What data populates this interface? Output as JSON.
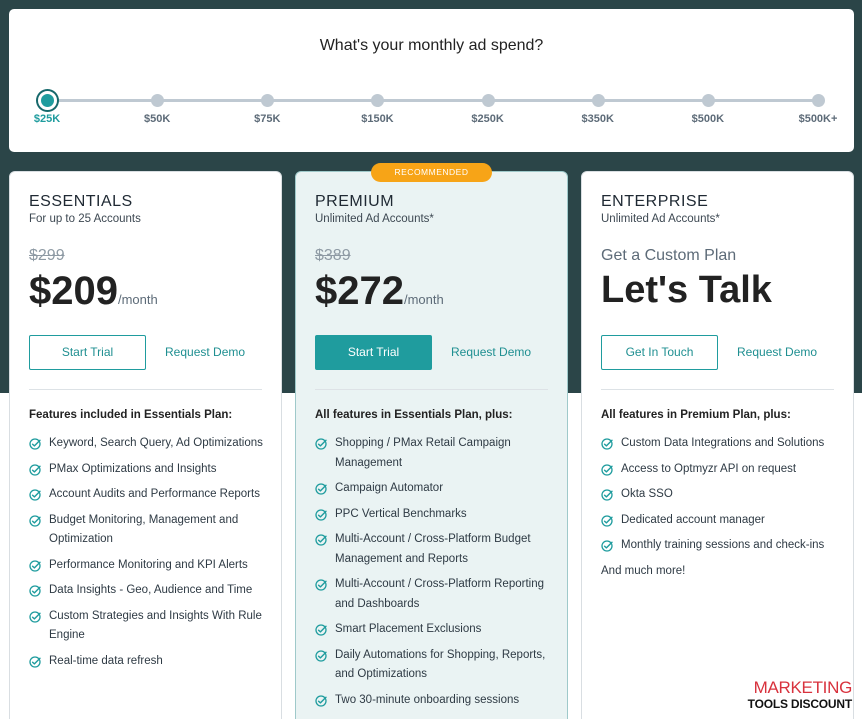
{
  "spend": {
    "title": "What's your monthly ad spend?",
    "stops": [
      "$25K",
      "$50K",
      "$75K",
      "$150K",
      "$250K",
      "$350K",
      "$500K",
      "$500K+"
    ],
    "selected_index": 0,
    "accent": "#1f9c9e"
  },
  "plans": {
    "essentials": {
      "name": "ESSENTIALS",
      "sub": "For up to 25 Accounts",
      "old_price": "$299",
      "price": "$209",
      "per": "/month",
      "primary_btn": "Start Trial",
      "link_btn": "Request Demo",
      "features_head": "Features included in Essentials Plan:",
      "features": [
        "Keyword, Search Query, Ad Optimizations",
        "PMax Optimizations and Insights",
        "Account Audits and Performance Reports",
        "Budget Monitoring, Management and Optimization",
        "Performance Monitoring and KPI Alerts",
        "Data Insights - Geo, Audience and Time",
        "Custom Strategies and Insights With Rule Engine",
        "Real-time data refresh"
      ]
    },
    "premium": {
      "badge": "RECOMMENDED",
      "name": "PREMIUM",
      "sub": "Unlimited Ad Accounts*",
      "old_price": "$389",
      "price": "$272",
      "per": "/month",
      "primary_btn": "Start Trial",
      "link_btn": "Request Demo",
      "features_head": "All features in Essentials Plan, plus:",
      "features": [
        "Shopping / PMax Retail Campaign Management",
        "Campaign Automator",
        "PPC Vertical Benchmarks",
        "Multi-Account / Cross-Platform Budget Management and Reports",
        "Multi-Account / Cross-Platform Reporting and Dashboards",
        "Smart Placement Exclusions",
        "Daily Automations for Shopping, Reports, and Optimizations",
        "Two 30-minute onboarding sessions"
      ]
    },
    "enterprise": {
      "name": "ENTERPRISE",
      "sub": "Unlimited Ad Accounts*",
      "custom_label": "Get a Custom Plan",
      "talk": "Let's Talk",
      "primary_btn": "Get In Touch",
      "link_btn": "Request Demo",
      "features_head": "All features in Premium Plan, plus:",
      "features": [
        "Custom Data Integrations and Solutions",
        "Access to Optmyzr API on request",
        "Okta SSO",
        "Dedicated account manager",
        "Monthly training sessions and check-ins"
      ],
      "more": "And much more!"
    }
  },
  "watermark": {
    "top": "MARKETING",
    "bottom": "TOOLS DISCOUNT"
  }
}
